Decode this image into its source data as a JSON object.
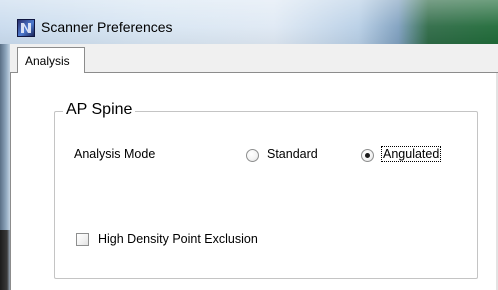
{
  "window": {
    "title": "Scanner Preferences",
    "icon": "scanner-app-icon",
    "background_badge": "...",
    "colors": {
      "titlebar": "#d8e6f3",
      "client": "#f0f0f0",
      "page": "#ffffff",
      "border": "#8c8c8c"
    }
  },
  "tabs": [
    {
      "label": "Analysis",
      "selected": true
    }
  ],
  "groupbox": {
    "title": "AP Spine",
    "analysis_mode": {
      "label": "Analysis Mode",
      "options": [
        {
          "label": "Standard",
          "checked": false
        },
        {
          "label": "Angulated",
          "checked": true
        }
      ]
    },
    "high_density": {
      "label": "High Density Point Exclusion",
      "checked": false
    }
  }
}
